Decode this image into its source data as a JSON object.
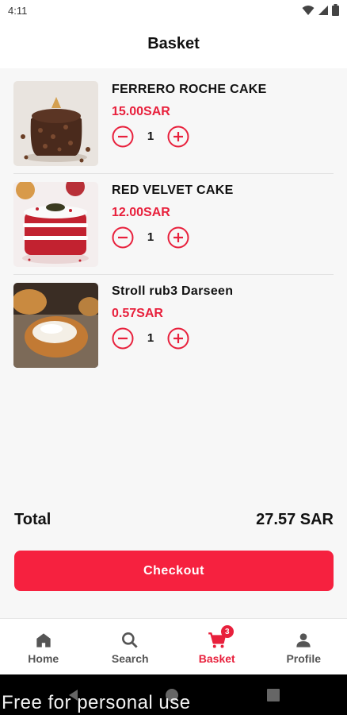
{
  "status": {
    "time": "4:11",
    "icons": [
      "wifi-icon",
      "signal-icon",
      "battery-icon"
    ]
  },
  "header": {
    "title": "Basket"
  },
  "items": [
    {
      "name": "FERRERO ROCHE CAKE",
      "price": "15.00SAR",
      "qty": "1",
      "image": "chocolate-cake"
    },
    {
      "name": "RED VELVET CAKE",
      "price": "12.00SAR",
      "qty": "1",
      "image": "red-velvet-cake"
    },
    {
      "name": "Stroll rub3 Darseen",
      "price": "0.57SAR",
      "qty": "1",
      "image": "pastry"
    }
  ],
  "summary": {
    "total_label": "Total",
    "total_value": "27.57 SAR"
  },
  "checkout": {
    "label": "Checkout"
  },
  "nav": {
    "items": [
      {
        "label": "Home",
        "icon": "home-icon"
      },
      {
        "label": "Search",
        "icon": "search-icon"
      },
      {
        "label": "Basket",
        "icon": "cart-icon",
        "badge": "3",
        "active": true
      },
      {
        "label": "Profile",
        "icon": "person-icon"
      }
    ]
  },
  "watermark": "Free for personal use",
  "colors": {
    "accent": "#e8203c",
    "button": "#f6213f",
    "background": "#f7f7f7"
  }
}
